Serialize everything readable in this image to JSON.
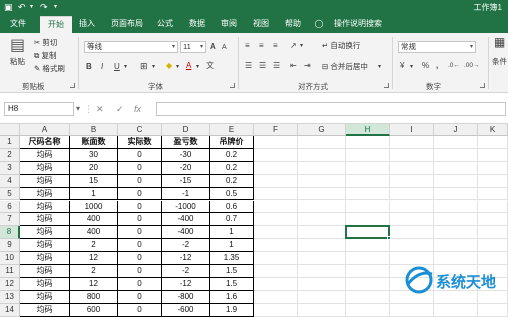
{
  "window": {
    "title": "工作簿1"
  },
  "tabs": [
    "文件",
    "开始",
    "插入",
    "页面布局",
    "公式",
    "数据",
    "审阅",
    "视图",
    "帮助",
    "操作说明搜索"
  ],
  "active_tab": "开始",
  "clipboard": {
    "paste": "粘贴",
    "cut": "剪切",
    "copy": "复制",
    "format_painter": "格式刷",
    "label": "剪贴板"
  },
  "font": {
    "name": "等线",
    "size": "11",
    "label": "字体",
    "bold": "B",
    "italic": "I",
    "underline": "U",
    "grow": "A",
    "shrink": "A",
    "font_color_letter": "A",
    "fill_icon": "◆"
  },
  "alignment": {
    "wrap": "自动换行",
    "merge": "合并后居中",
    "label": "对齐方式"
  },
  "number": {
    "format": "常规",
    "label": "数字",
    "currency": "¥",
    "percent": "%",
    "comma": ","
  },
  "styles": {
    "partial": "条件"
  },
  "formula_bar": {
    "cell_ref": "H8",
    "cancel": "✕",
    "confirm": "✓",
    "fx": "fx",
    "value": ""
  },
  "columns": [
    "A",
    "B",
    "C",
    "D",
    "E",
    "F",
    "G",
    "H",
    "I",
    "J",
    "K"
  ],
  "rows": [
    "1",
    "2",
    "3",
    "4",
    "5",
    "6",
    "7",
    "8",
    "9",
    "10",
    "11",
    "12",
    "13",
    "14"
  ],
  "table": {
    "headers": [
      "尺码名称",
      "账面数",
      "实际数",
      "盈亏数",
      "吊牌价"
    ],
    "rows": [
      [
        "均码",
        "30",
        "0",
        "-30",
        "0.2"
      ],
      [
        "均码",
        "20",
        "0",
        "-20",
        "0.2"
      ],
      [
        "均码",
        "15",
        "0",
        "-15",
        "0.2"
      ],
      [
        "均码",
        "1",
        "0",
        "-1",
        "0.5"
      ],
      [
        "均码",
        "1000",
        "0",
        "-1000",
        "0.6"
      ],
      [
        "均码",
        "400",
        "0",
        "-400",
        "0.7"
      ],
      [
        "均码",
        "400",
        "0",
        "-400",
        "1"
      ],
      [
        "均码",
        "2",
        "0",
        "-2",
        "1"
      ],
      [
        "均码",
        "12",
        "0",
        "-12",
        "1.35"
      ],
      [
        "均码",
        "2",
        "0",
        "-2",
        "1.5"
      ],
      [
        "均码",
        "12",
        "0",
        "-12",
        "1.5"
      ],
      [
        "均码",
        "800",
        "0",
        "-800",
        "1.6"
      ],
      [
        "均码",
        "600",
        "0",
        "-600",
        "1.9"
      ]
    ]
  },
  "selected": {
    "column": "H",
    "row": "8"
  },
  "watermark": {
    "text": "系统天地"
  }
}
